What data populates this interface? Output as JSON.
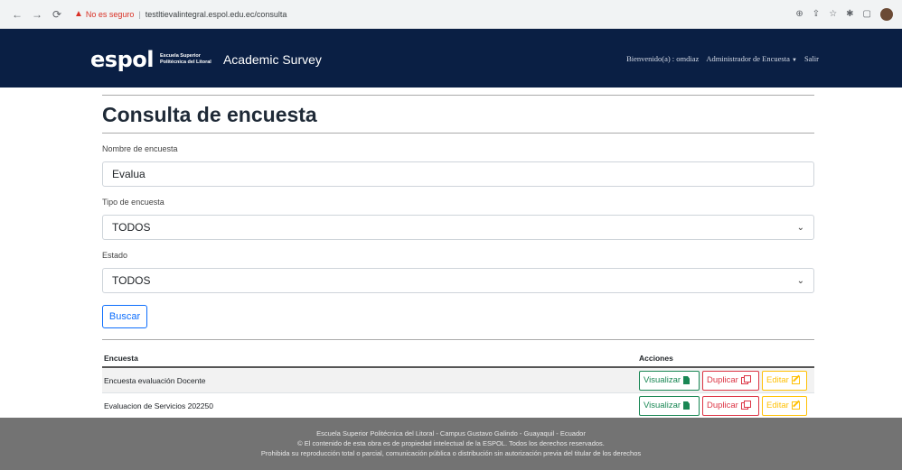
{
  "browser": {
    "security_label": "No es seguro",
    "url": "testltievalintegral.espol.edu.ec/consulta"
  },
  "navbar": {
    "logo_word": "espol",
    "logo_sub_line1": "Escuela Superior",
    "logo_sub_line2": "Politécnica del Litoral",
    "app_title": "Academic Survey",
    "welcome": "Bienvenido(a) : omdiaz",
    "admin_menu": "Administrador de Encuesta",
    "logout": "Salir"
  },
  "page": {
    "title": "Consulta de encuesta"
  },
  "form": {
    "name_label": "Nombre de encuesta",
    "name_value": "Evalua",
    "type_label": "Tipo de encuesta",
    "type_value": "TODOS",
    "state_label": "Estado",
    "state_value": "TODOS",
    "search_button": "Buscar"
  },
  "table": {
    "headers": [
      "Encuesta",
      "Acciones"
    ],
    "rows": [
      {
        "name": "Encuesta evaluación Docente"
      },
      {
        "name": "Evaluacion de Servicios 202250"
      }
    ],
    "action_view": "Visualizar",
    "action_duplicate": "Duplicar",
    "action_edit": "Editar"
  },
  "footer": {
    "line1": "Escuela Superior Politécnica del Litoral - Campus Gustavo Galindo - Guayaquil - Ecuador",
    "line2": "© El contenido de esta obra es de propiedad intelectual de la ESPOL. Todos los derechos reservados.",
    "line3": "Prohibida su reproducción total o parcial, comunicación pública o distribución sin autorización previa del titular de los derechos"
  },
  "colors": {
    "navbar_bg": "#0a1f44",
    "footer_bg": "#737373",
    "primary": "#0d6efd",
    "success": "#198754",
    "danger": "#dc3545",
    "warning": "#ffc107"
  },
  "icons": [
    "back-arrow-icon",
    "forward-arrow-icon",
    "reload-icon",
    "warning-icon",
    "zoom-icon",
    "share-icon",
    "star-icon",
    "extensions-icon",
    "sidebar-icon",
    "chevron-down-icon",
    "file-icon",
    "copy-icon",
    "edit-icon"
  ]
}
